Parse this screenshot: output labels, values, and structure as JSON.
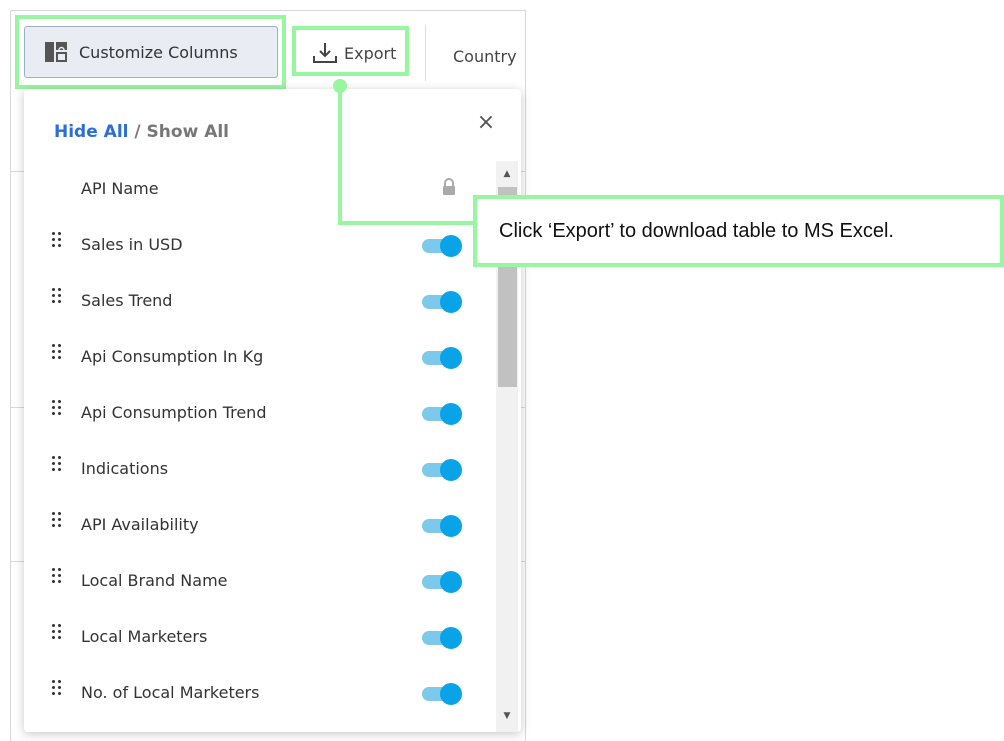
{
  "toolbar": {
    "customize_label": "Customize Columns",
    "export_label": "Export",
    "country_header": "Country"
  },
  "panel": {
    "hide_all": "Hide All",
    "separator": "/",
    "show_all": "Show All",
    "close_symbol": "×",
    "locked_item": {
      "label": "API Name",
      "locked": true
    },
    "items": [
      {
        "label": "Sales in USD",
        "enabled": true
      },
      {
        "label": "Sales Trend",
        "enabled": true
      },
      {
        "label": "Api Consumption In Kg",
        "enabled": true
      },
      {
        "label": "Api Consumption Trend",
        "enabled": true
      },
      {
        "label": "Indications",
        "enabled": true
      },
      {
        "label": "API Availability",
        "enabled": true
      },
      {
        "label": "Local Brand Name",
        "enabled": true
      },
      {
        "label": "Local Marketers",
        "enabled": true
      },
      {
        "label": "No. of Local Marketers",
        "enabled": true
      }
    ]
  },
  "callout": {
    "text": "Click ‘Export’ to download table to MS Excel."
  },
  "colors": {
    "highlight": "#98f5a0",
    "link": "#2b6fd6",
    "toggle_knob": "#0aa3e8",
    "toggle_track": "#7cc9ec"
  },
  "icons": {
    "customize": "columns-lock-icon",
    "export": "download-icon",
    "close": "close-icon",
    "lock": "lock-icon",
    "drag": "drag-handle-icon"
  }
}
